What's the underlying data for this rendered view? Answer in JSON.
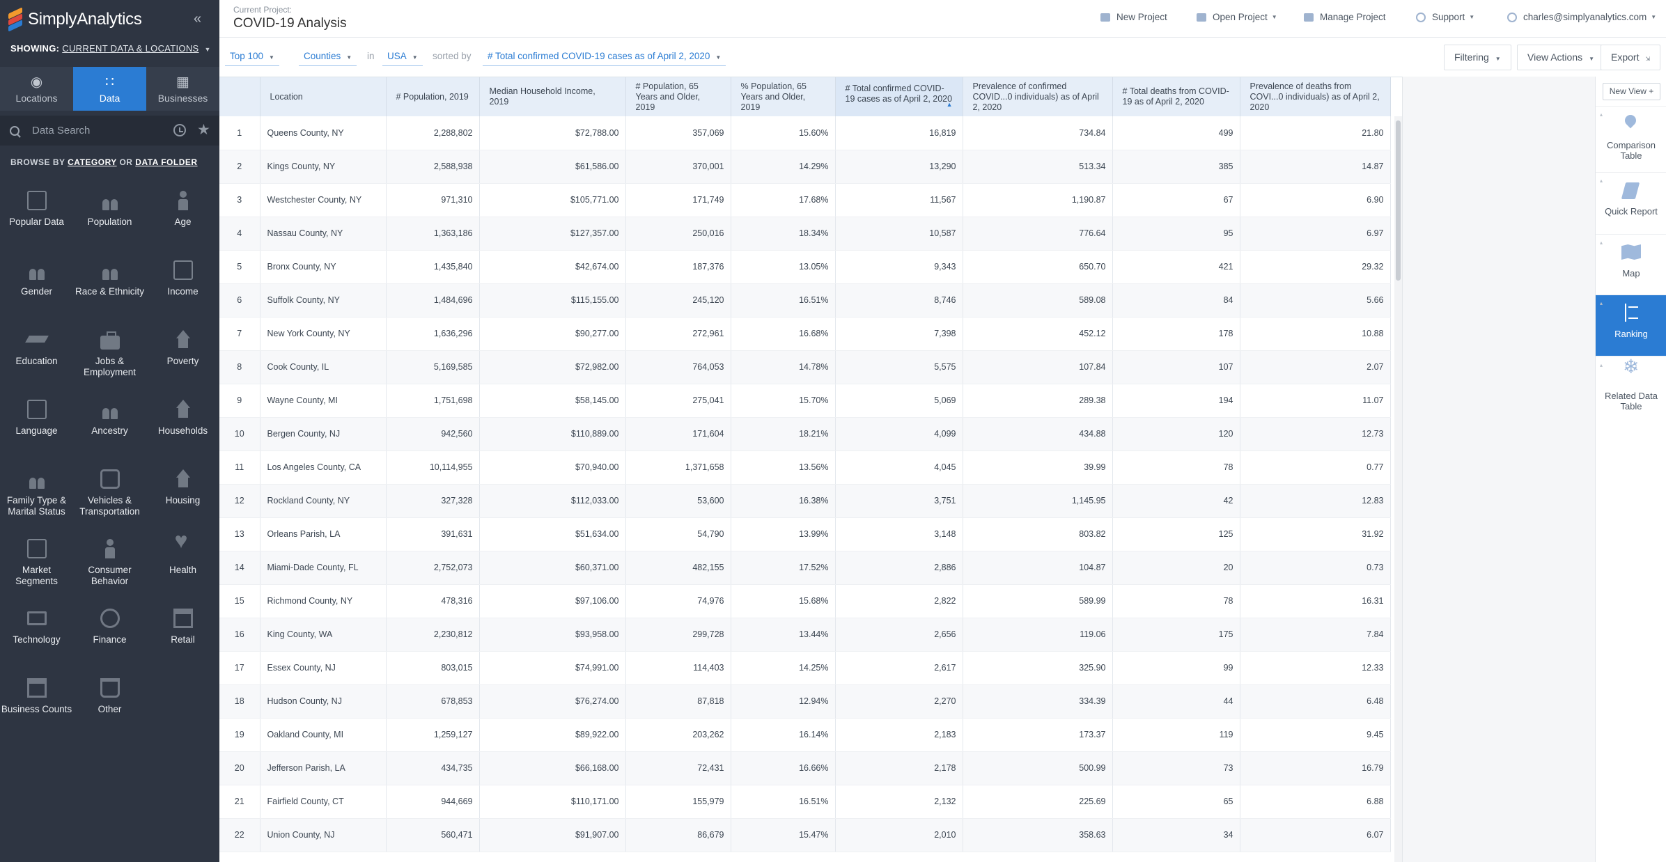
{
  "app": {
    "name": "SimplyAnalytics"
  },
  "sidebar": {
    "showing_label": "SHOWING:",
    "showing_value": "Current Data & Locations",
    "modes": [
      {
        "label": "Locations",
        "icon": "location-pin-icon"
      },
      {
        "label": "Data",
        "icon": "grid-icon",
        "active": true
      },
      {
        "label": "Businesses",
        "icon": "building-icon"
      }
    ],
    "search_placeholder": "Data Search",
    "browse_prefix": "BROWSE BY",
    "browse_category": "CATEGORY",
    "browse_or": "OR",
    "browse_folder": "DATA FOLDER",
    "categories": [
      {
        "label": "Popular Data",
        "icon": "box"
      },
      {
        "label": "Population",
        "icon": "people"
      },
      {
        "label": "Age",
        "icon": "person"
      },
      {
        "label": "Gender",
        "icon": "people"
      },
      {
        "label": "Race & Ethnicity",
        "icon": "people"
      },
      {
        "label": "Income",
        "icon": "box"
      },
      {
        "label": "Education",
        "icon": "cap"
      },
      {
        "label": "Jobs & Employment",
        "icon": "brief"
      },
      {
        "label": "Poverty",
        "icon": "house"
      },
      {
        "label": "Language",
        "icon": "box"
      },
      {
        "label": "Ancestry",
        "icon": "people"
      },
      {
        "label": "Households",
        "icon": "house"
      },
      {
        "label": "Family Type & Marital Status",
        "icon": "people"
      },
      {
        "label": "Vehicles & Transportation",
        "icon": "bus"
      },
      {
        "label": "Housing",
        "icon": "house"
      },
      {
        "label": "Market Segments",
        "icon": "box"
      },
      {
        "label": "Consumer Behavior",
        "icon": "person"
      },
      {
        "label": "Health",
        "icon": "heart"
      },
      {
        "label": "Technology",
        "icon": "monitor"
      },
      {
        "label": "Finance",
        "icon": "coin"
      },
      {
        "label": "Retail",
        "icon": "store"
      },
      {
        "label": "Business Counts",
        "icon": "store"
      },
      {
        "label": "Other",
        "icon": "bin"
      }
    ]
  },
  "header": {
    "project_label": "Current Project:",
    "project_name": "COVID-19 Analysis",
    "new_project": "New Project",
    "open_project": "Open Project",
    "manage_project": "Manage Project",
    "support": "Support",
    "user": "charles@simplyanalytics.com"
  },
  "toolbar": {
    "top": "Top 100",
    "geo": "Counties",
    "in_label": "in",
    "region": "USA",
    "sorted_by_label": "sorted by",
    "sort_field": "# Total confirmed COVID-19 cases as of April 2, 2020",
    "filtering": "Filtering",
    "view_actions": "View Actions",
    "export": "Export"
  },
  "table": {
    "columns": [
      "",
      "Location",
      "# Population, 2019",
      "Median Household Income, 2019",
      "# Population, 65 Years and Older, 2019",
      "% Population, 65 Years and Older, 2019",
      "# Total confirmed COVID-19 cases as of April 2, 2020",
      "Prevalence of confirmed COVID...0 individuals) as of April 2, 2020",
      "# Total deaths from COVID-19 as of April 2, 2020",
      "Prevalence of deaths from COVI...0 individuals) as of April 2, 2020"
    ],
    "rows": [
      [
        "1",
        "Queens County, NY",
        "2,288,802",
        "$72,788.00",
        "357,069",
        "15.60%",
        "16,819",
        "734.84",
        "499",
        "21.80"
      ],
      [
        "2",
        "Kings County, NY",
        "2,588,938",
        "$61,586.00",
        "370,001",
        "14.29%",
        "13,290",
        "513.34",
        "385",
        "14.87"
      ],
      [
        "3",
        "Westchester County, NY",
        "971,310",
        "$105,771.00",
        "171,749",
        "17.68%",
        "11,567",
        "1,190.87",
        "67",
        "6.90"
      ],
      [
        "4",
        "Nassau County, NY",
        "1,363,186",
        "$127,357.00",
        "250,016",
        "18.34%",
        "10,587",
        "776.64",
        "95",
        "6.97"
      ],
      [
        "5",
        "Bronx County, NY",
        "1,435,840",
        "$42,674.00",
        "187,376",
        "13.05%",
        "9,343",
        "650.70",
        "421",
        "29.32"
      ],
      [
        "6",
        "Suffolk County, NY",
        "1,484,696",
        "$115,155.00",
        "245,120",
        "16.51%",
        "8,746",
        "589.08",
        "84",
        "5.66"
      ],
      [
        "7",
        "New York County, NY",
        "1,636,296",
        "$90,277.00",
        "272,961",
        "16.68%",
        "7,398",
        "452.12",
        "178",
        "10.88"
      ],
      [
        "8",
        "Cook County, IL",
        "5,169,585",
        "$72,982.00",
        "764,053",
        "14.78%",
        "5,575",
        "107.84",
        "107",
        "2.07"
      ],
      [
        "9",
        "Wayne County, MI",
        "1,751,698",
        "$58,145.00",
        "275,041",
        "15.70%",
        "5,069",
        "289.38",
        "194",
        "11.07"
      ],
      [
        "10",
        "Bergen County, NJ",
        "942,560",
        "$110,889.00",
        "171,604",
        "18.21%",
        "4,099",
        "434.88",
        "120",
        "12.73"
      ],
      [
        "11",
        "Los Angeles County, CA",
        "10,114,955",
        "$70,940.00",
        "1,371,658",
        "13.56%",
        "4,045",
        "39.99",
        "78",
        "0.77"
      ],
      [
        "12",
        "Rockland County, NY",
        "327,328",
        "$112,033.00",
        "53,600",
        "16.38%",
        "3,751",
        "1,145.95",
        "42",
        "12.83"
      ],
      [
        "13",
        "Orleans Parish, LA",
        "391,631",
        "$51,634.00",
        "54,790",
        "13.99%",
        "3,148",
        "803.82",
        "125",
        "31.92"
      ],
      [
        "14",
        "Miami-Dade County, FL",
        "2,752,073",
        "$60,371.00",
        "482,155",
        "17.52%",
        "2,886",
        "104.87",
        "20",
        "0.73"
      ],
      [
        "15",
        "Richmond County, NY",
        "478,316",
        "$97,106.00",
        "74,976",
        "15.68%",
        "2,822",
        "589.99",
        "78",
        "16.31"
      ],
      [
        "16",
        "King County, WA",
        "2,230,812",
        "$93,958.00",
        "299,728",
        "13.44%",
        "2,656",
        "119.06",
        "175",
        "7.84"
      ],
      [
        "17",
        "Essex County, NJ",
        "803,015",
        "$74,991.00",
        "114,403",
        "14.25%",
        "2,617",
        "325.90",
        "99",
        "12.33"
      ],
      [
        "18",
        "Hudson County, NJ",
        "678,853",
        "$76,274.00",
        "87,818",
        "12.94%",
        "2,270",
        "334.39",
        "44",
        "6.48"
      ],
      [
        "19",
        "Oakland County, MI",
        "1,259,127",
        "$89,922.00",
        "203,262",
        "16.14%",
        "2,183",
        "173.37",
        "119",
        "9.45"
      ],
      [
        "20",
        "Jefferson Parish, LA",
        "434,735",
        "$66,168.00",
        "72,431",
        "16.66%",
        "2,178",
        "500.99",
        "73",
        "16.79"
      ],
      [
        "21",
        "Fairfield County, CT",
        "944,669",
        "$110,171.00",
        "155,979",
        "16.51%",
        "2,132",
        "225.69",
        "65",
        "6.88"
      ],
      [
        "22",
        "Union County, NJ",
        "560,471",
        "$91,907.00",
        "86,679",
        "15.47%",
        "2,010",
        "358.63",
        "34",
        "6.07"
      ]
    ]
  },
  "views": {
    "new_view": "New View +",
    "items": [
      {
        "label": "Comparison Table",
        "icon": "pin"
      },
      {
        "label": "Quick Report",
        "icon": "scroll"
      },
      {
        "label": "Map",
        "icon": "map"
      },
      {
        "label": "Ranking",
        "icon": "rank",
        "active": true
      },
      {
        "label": "Related Data Table",
        "icon": "snow"
      }
    ]
  },
  "colors": {
    "accent": "#2b7cd3",
    "sidebar": "#2e3542"
  }
}
